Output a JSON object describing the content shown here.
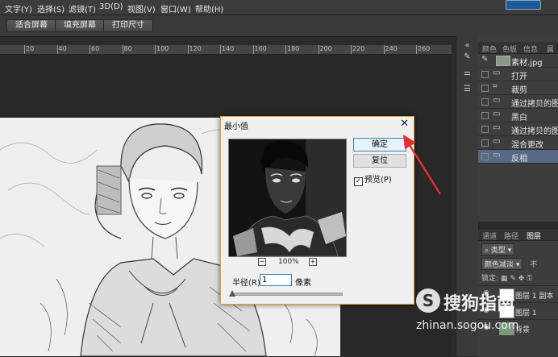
{
  "menu": {
    "items": [
      "文字(Y)",
      "选择(S)",
      "滤镜(T)",
      "3D(D)",
      "视图(V)",
      "窗口(W)",
      "帮助(H)"
    ]
  },
  "options_bar": {
    "buttons": [
      "适合屏幕",
      "填充屏幕",
      "打印尺寸"
    ]
  },
  "ruler": {
    "ticks": [
      "20",
      "40",
      "60",
      "80",
      "100",
      "120",
      "140",
      "160",
      "180",
      "200",
      "220",
      "240",
      "260"
    ]
  },
  "dialog": {
    "title": "最小值",
    "close_glyph": "✕",
    "ok_label": "确定",
    "reset_label": "复位",
    "preview_label": "预览(P)",
    "preview_checked": true,
    "zoom_out": "−",
    "zoom_value": "100%",
    "zoom_in": "+",
    "radius_label": "半径(R):",
    "radius_value": "1",
    "radius_unit": "像素",
    "radius_slider_fraction": 0.0
  },
  "panels": {
    "tabs_top": [
      "颜色",
      "色板",
      "信息",
      "属"
    ],
    "history_items": [
      {
        "label": "素材.jpg",
        "icon": "snapshot-icon"
      },
      {
        "label": "打开",
        "icon": "history-step-icon"
      },
      {
        "label": "裁剪",
        "icon": "crop-icon"
      },
      {
        "label": "通过拷贝的图层",
        "icon": "history-step-icon"
      },
      {
        "label": "黑白",
        "icon": "history-step-icon"
      },
      {
        "label": "通过拷贝的图层",
        "icon": "history-step-icon"
      },
      {
        "label": "混合更改",
        "icon": "history-step-icon"
      },
      {
        "label": "反相",
        "icon": "history-step-icon",
        "selected": true
      }
    ],
    "tabs_bottom": [
      "通道",
      "路径",
      "图层"
    ],
    "layers": {
      "filter_label": "类型",
      "blend_mode": "颜色减淡",
      "opacity_prefix": "不",
      "lock_label": "锁定:",
      "items": [
        "图层 1 副本",
        "图层 1",
        "背景"
      ]
    }
  },
  "watermark": {
    "logo": "S",
    "brand": "搜狗指南",
    "url": "zhinan.sogou.com"
  },
  "colors": {
    "accent_dialog_border": "#e2a12c",
    "selection": "#566a86",
    "arrow": "#e03030"
  }
}
